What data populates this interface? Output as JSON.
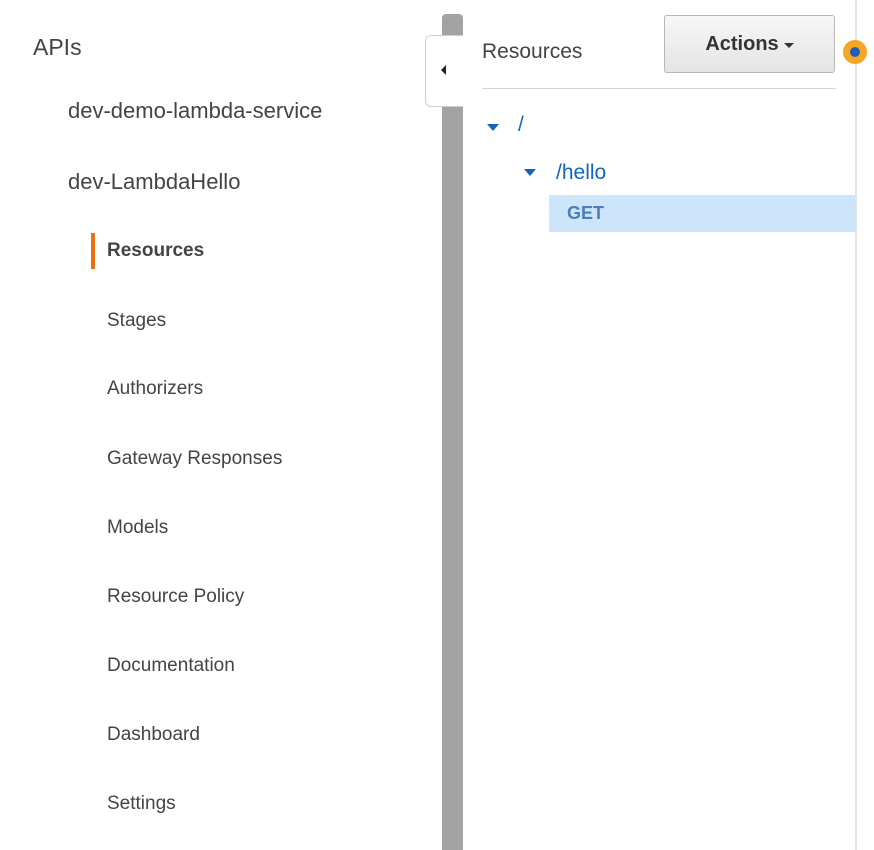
{
  "sidebar": {
    "heading": "APIs",
    "apis": [
      {
        "name": "dev-demo-lambda-service"
      },
      {
        "name": "dev-LambdaHello"
      }
    ],
    "nav": [
      {
        "label": "Resources",
        "active": true
      },
      {
        "label": "Stages"
      },
      {
        "label": "Authorizers"
      },
      {
        "label": "Gateway Responses"
      },
      {
        "label": "Models"
      },
      {
        "label": "Resource Policy"
      },
      {
        "label": "Documentation"
      },
      {
        "label": "Dashboard"
      },
      {
        "label": "Settings"
      }
    ],
    "collapse_icon": "chevron-left-icon"
  },
  "resources_panel": {
    "title": "Resources",
    "actions_label": "Actions",
    "tree": {
      "root": {
        "path": "/"
      },
      "child": {
        "path": "/hello"
      },
      "method": {
        "label": "GET",
        "selected": true
      }
    }
  },
  "colors": {
    "accent_active": "#ec7211",
    "link": "#1166bb",
    "selected_row": "#cde5fb",
    "method_text": "#4a7fb8",
    "help_dot": "#f5a623"
  }
}
